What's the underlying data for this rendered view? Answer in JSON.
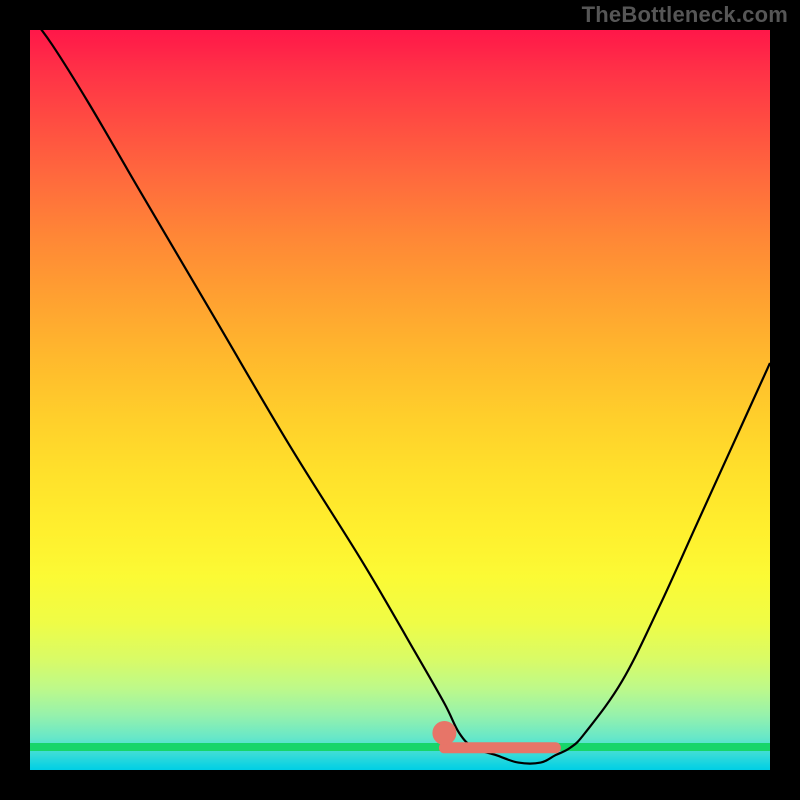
{
  "attribution": "TheBottleneck.com",
  "chart_data": {
    "type": "line",
    "title": "",
    "xlabel": "",
    "ylabel": "",
    "xlim": [
      0,
      100
    ],
    "ylim": [
      0,
      100
    ],
    "series": [
      {
        "name": "bottleneck-curve",
        "x": [
          0,
          3,
          8,
          15,
          25,
          35,
          45,
          52,
          56,
          58,
          60,
          63,
          66,
          69,
          71,
          73,
          75,
          80,
          85,
          90,
          95,
          100
        ],
        "values": [
          102,
          98,
          90,
          78,
          61,
          44,
          28,
          16,
          9,
          5,
          3,
          2,
          1,
          1,
          2,
          3,
          5,
          12,
          22,
          33,
          44,
          55
        ]
      }
    ],
    "markers": {
      "salmon_strip": {
        "x_start": 56,
        "x_end": 71,
        "y": 3,
        "color": "#e77568"
      },
      "salmon_dot": {
        "x": 56,
        "y": 5,
        "r": 1.2,
        "color": "#e77568"
      }
    },
    "gradient_stops": [
      {
        "pos": 0,
        "color": "#ff1749"
      },
      {
        "pos": 0.5,
        "color": "#ffe12b"
      },
      {
        "pos": 0.96,
        "color": "#17d56a"
      },
      {
        "pos": 1.0,
        "color": "#00cfe5"
      }
    ]
  }
}
